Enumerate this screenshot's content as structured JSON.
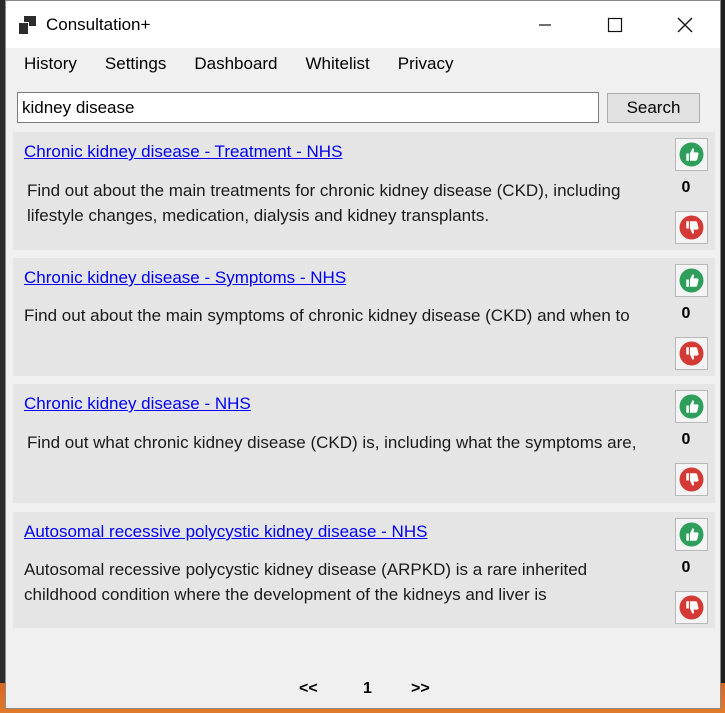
{
  "window": {
    "title": "Consultation+",
    "minimize_glyph": "—",
    "maximize_glyph": "☐",
    "close_glyph": "✕"
  },
  "menu": {
    "items": [
      {
        "label": "History"
      },
      {
        "label": "Settings"
      },
      {
        "label": "Dashboard"
      },
      {
        "label": "Whitelist"
      },
      {
        "label": "Privacy"
      }
    ]
  },
  "search": {
    "value": "kidney disease",
    "button_label": "Search"
  },
  "results": [
    {
      "title": "Chronic kidney disease - Treatment - NHS",
      "description": "Find out about the main treatments for chronic kidney disease (CKD), including lifestyle changes, medication, dialysis and kidney transplants.",
      "votes": "0"
    },
    {
      "title": "Chronic kidney disease - Symptoms - NHS",
      "description": "Find out about the main symptoms of chronic kidney disease (CKD) and when to",
      "votes": "0"
    },
    {
      "title": "Chronic kidney disease - NHS",
      "description": "Find out what chronic kidney disease (CKD) is, including what the symptoms are,",
      "votes": "0"
    },
    {
      "title": "Autosomal recessive polycystic kidney disease - NHS",
      "description": "Autosomal recessive polycystic kidney disease (ARPKD) is a rare inherited childhood condition where the development of the kidneys and liver is",
      "votes": "0"
    }
  ],
  "pager": {
    "prev_label": "<<",
    "current_page": "1",
    "next_label": ">>"
  },
  "icons": {
    "thumbs_up": "thumbs-up-icon",
    "thumbs_down": "thumbs-down-icon"
  },
  "colors": {
    "link": "#0000ee",
    "upvote": "#2e9e5b",
    "downvote": "#d33a35",
    "card_background": "#e5e5e5"
  }
}
